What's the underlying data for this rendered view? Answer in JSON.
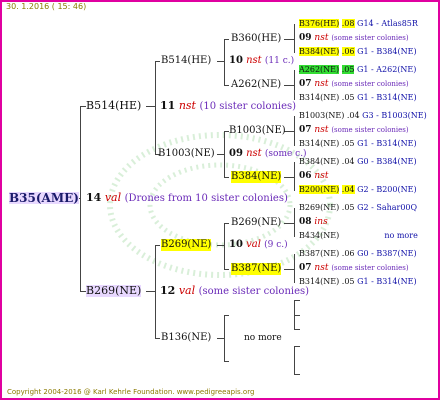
{
  "header": {
    "date": "30. 1.2016 ( 15: 46)"
  },
  "footer": {
    "copyright": "Copyright 2004-2016 @ Karl Kehrle Foundation.   www.pedigreeapis.org"
  },
  "tree": {
    "root": {
      "label": "B35(AME)"
    },
    "root_ann": {
      "num": "14",
      "kind": "val",
      "note": "(Drones from 10 sister colonies)"
    },
    "father": {
      "label": "B514(HE)",
      "num": "11",
      "kind": "nst",
      "note": "(10 sister colonies)"
    },
    "mother": {
      "label": "B269(NE)",
      "num": "12",
      "kind": "val",
      "note": "(some sister colonies)"
    },
    "ff": {
      "label": "B514(HE)",
      "num": "10",
      "kind": "nst",
      "note": "(11 c.)"
    },
    "fm": {
      "label": "B1003(NE)",
      "num": "09",
      "kind": "nst",
      "note": "(some c.)"
    },
    "mf": {
      "label": "B269(NE)",
      "num": "10",
      "kind": "val",
      "note": "(9 c.)"
    },
    "mm": {
      "label": "B136(NE)",
      "more": "no more"
    },
    "fff": {
      "label": "B360(HE)"
    },
    "ffm": {
      "label": "A262(NE)"
    },
    "fmf": {
      "label": "B1003(NE)"
    },
    "fmm": {
      "label": "B384(NE)"
    },
    "mff": {
      "label": "B269(NE)"
    },
    "mfm": {
      "label": "B387(NE)"
    },
    "g4": [
      {
        "label": "B376(HE)",
        "val": ".08",
        "code": "G14 - Atlas85R"
      },
      {
        "num": "09",
        "kind": "nst",
        "note": "(some sister colonies)"
      },
      {
        "label": "B384(NE)",
        "val": ".06",
        "code": "G1 - B384(NE)"
      },
      {
        "label": "A262(NE)",
        "val": ".05",
        "code": "G1 - A262(NE)"
      },
      {
        "num": "07",
        "kind": "nst",
        "note": "(some sister colonies)"
      },
      {
        "label": "B314(NE)",
        "val": ".05",
        "code": "G1 - B314(NE)"
      },
      {
        "label": "B1003(NE)",
        "val": ".04",
        "code": "G3 - B1003(NE)"
      },
      {
        "num": "07",
        "kind": "nst",
        "note": "(some sister colonies)"
      },
      {
        "label": "B314(NE)",
        "val": ".05",
        "code": "G1 - B314(NE)"
      },
      {
        "label": "B384(NE)",
        "val": ".04",
        "code": "G0 - B384(NE)"
      },
      {
        "num": "06",
        "kind": "nst",
        "note": ""
      },
      {
        "label": "B200(NE)",
        "val": ".04",
        "code": "G2 - B200(NE)"
      },
      {
        "label": "B269(NE)",
        "val": ".05",
        "code": "G2 - Sahar00Q"
      },
      {
        "num": "08",
        "kind": "ins",
        "note": ""
      },
      {
        "label": "B434(NE)",
        "val": "",
        "code": "no more"
      },
      {
        "label": "B387(NE)",
        "val": ".06",
        "code": "G0 - B387(NE)"
      },
      {
        "num": "07",
        "kind": "nst",
        "note": "(some sister colonies)"
      },
      {
        "label": "B314(NE)",
        "val": ".05",
        "code": "G1 - B314(NE)"
      }
    ]
  }
}
